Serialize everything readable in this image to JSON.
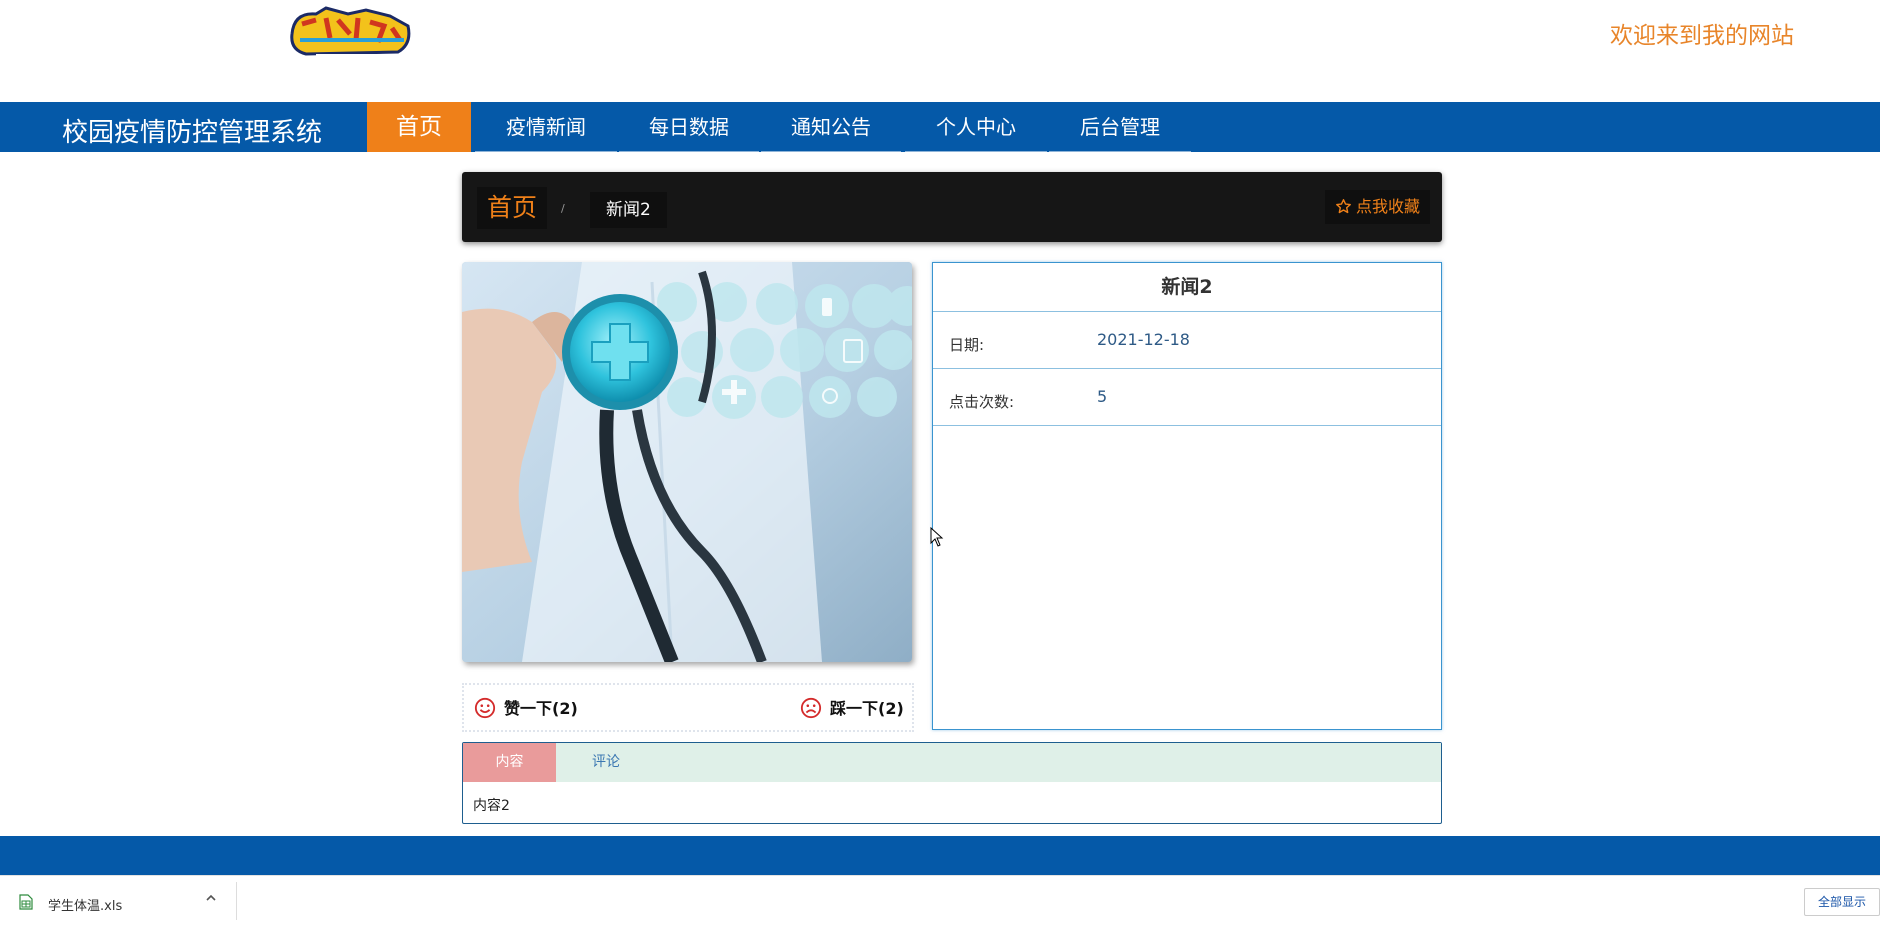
{
  "header": {
    "welcome": "欢迎来到我的网站"
  },
  "nav": {
    "site_title": "校园疫情防控管理系统",
    "items": [
      {
        "label": "首页",
        "active": true
      },
      {
        "label": "疫情新闻"
      },
      {
        "label": "每日数据"
      },
      {
        "label": "通知公告"
      },
      {
        "label": "个人中心"
      },
      {
        "label": "后台管理"
      }
    ]
  },
  "breadcrumb": {
    "home": "首页",
    "separator": "/",
    "current": "新闻2",
    "favorite": "点我收藏"
  },
  "votes": {
    "like": "赞一下(2)",
    "dislike": "踩一下(2)"
  },
  "info": {
    "title": "新闻2",
    "rows": [
      {
        "label": "日期:",
        "value": "2021-12-18"
      },
      {
        "label": "点击次数:",
        "value": "5"
      }
    ]
  },
  "tabs": {
    "items": [
      {
        "label": "内容",
        "active": true
      },
      {
        "label": "评论"
      }
    ],
    "content": "内容2"
  },
  "download": {
    "filename": "学生体温.xls",
    "show_all": "全部显示"
  },
  "colors": {
    "nav_bg": "#0559a8",
    "accent": "#ef8019",
    "welcome": "#e8852a",
    "crumb_bg": "#161616"
  }
}
